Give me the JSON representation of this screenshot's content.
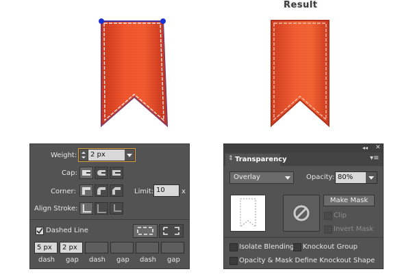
{
  "result_label": "Result",
  "stroke_panel": {
    "weight_label": "Weight:",
    "weight_value": "2 px",
    "cap_label": "Cap:",
    "corner_label": "Corner:",
    "limit_label": "Limit:",
    "limit_value": "10",
    "limit_unit": "x",
    "align_label": "Align Stroke:",
    "dashed_label": "Dashed Line",
    "dashed_checked": true,
    "dash_fields": [
      {
        "value": "5 px",
        "caption": "dash"
      },
      {
        "value": "2 px",
        "caption": "gap"
      },
      {
        "value": "",
        "caption": "dash"
      },
      {
        "value": "",
        "caption": "gap"
      },
      {
        "value": "",
        "caption": "dash"
      },
      {
        "value": "",
        "caption": "gap"
      }
    ]
  },
  "transparency_panel": {
    "tab_title": "Transparency",
    "blend_mode": "Overlay",
    "opacity_label": "Opacity:",
    "opacity_value": "80%",
    "make_mask_label": "Make Mask",
    "clip_label": "Clip",
    "invert_mask_label": "Invert Mask",
    "isolate_label": "Isolate Blending",
    "knockout_label": "Knockout Group",
    "opacity_mask_label": "Opacity & Mask Define Knockout Shape"
  },
  "colors": {
    "ribbon": "#e0421c",
    "ribbon_dark": "#b82d12",
    "panel_bg": "#535353",
    "selection_anchor": "#1a33d6",
    "weight_highlight": "#e0a23a"
  }
}
